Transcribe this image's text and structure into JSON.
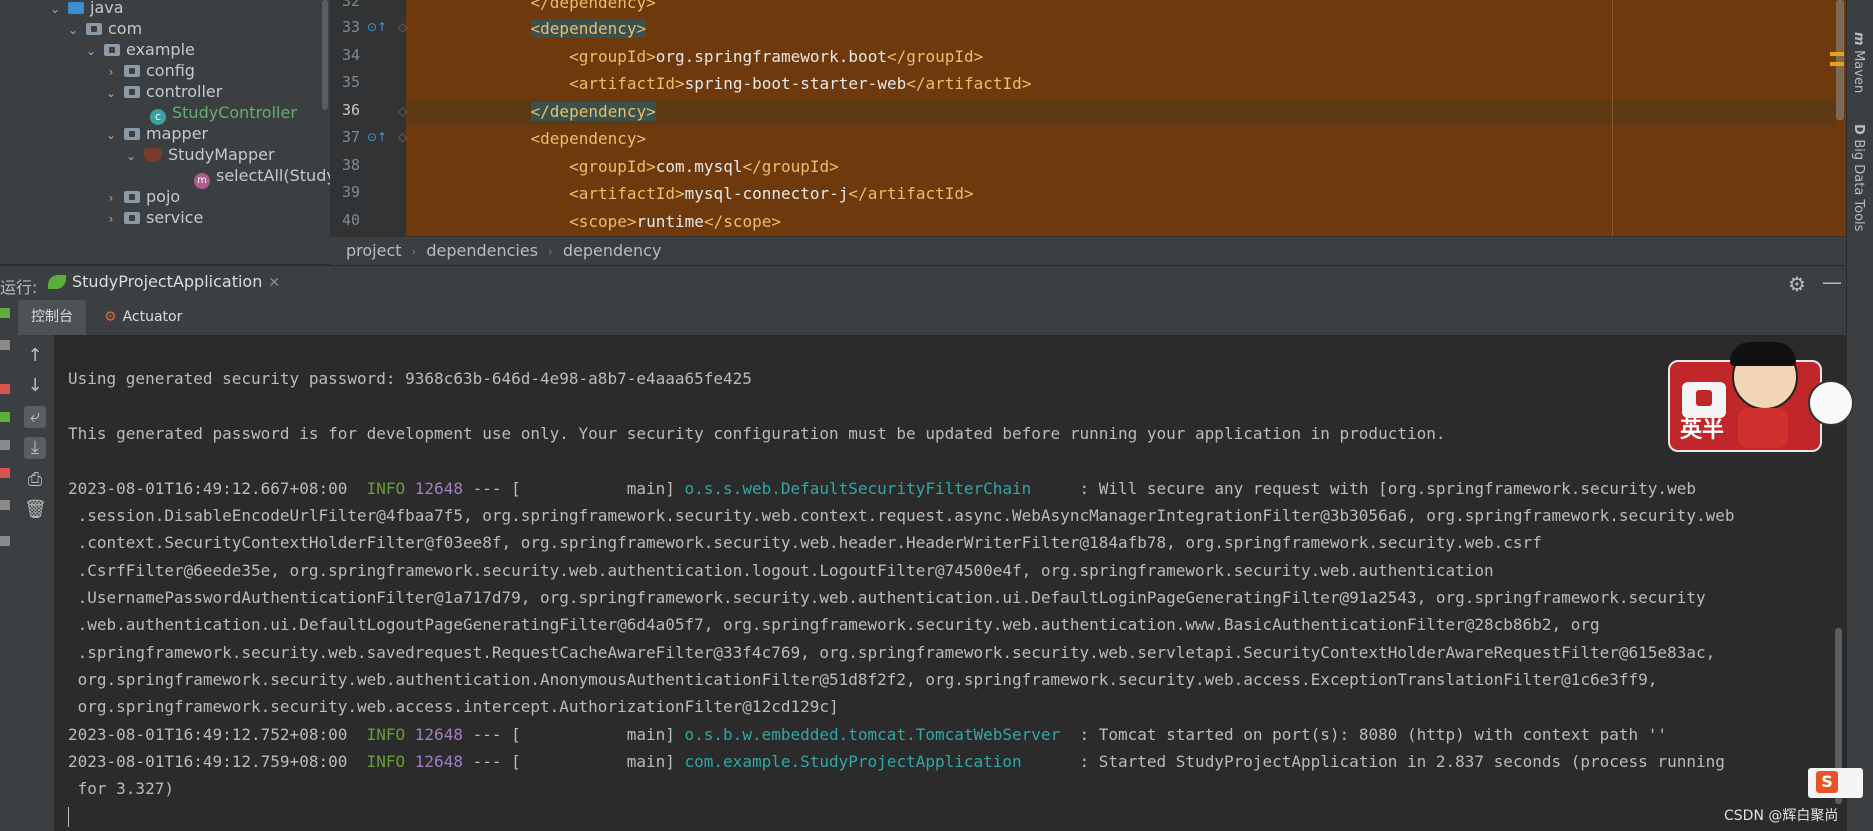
{
  "project_tree": {
    "items": [
      {
        "label": "java",
        "depth": 0,
        "chevron": "⌄",
        "icon": "folder-source-icon"
      },
      {
        "label": "com",
        "depth": 1,
        "chevron": "⌄",
        "icon": "package-icon"
      },
      {
        "label": "example",
        "depth": 2,
        "chevron": "⌄",
        "icon": "package-icon"
      },
      {
        "label": "config",
        "depth": 3,
        "chevron": "›",
        "icon": "package-icon"
      },
      {
        "label": "controller",
        "depth": 3,
        "chevron": "⌄",
        "icon": "package-icon"
      },
      {
        "label": "StudyController",
        "depth": 4,
        "chevron": "",
        "icon": "class-icon"
      },
      {
        "label": "mapper",
        "depth": 3,
        "chevron": "⌄",
        "icon": "package-icon"
      },
      {
        "label": "StudyMapper",
        "depth": 4,
        "chevron": "⌄",
        "icon": "mybatis-mapper-icon"
      },
      {
        "label": "selectAll(Study):",
        "depth": 5,
        "chevron": "",
        "icon": "method-icon"
      },
      {
        "label": "pojo",
        "depth": 3,
        "chevron": "›",
        "icon": "package-icon"
      },
      {
        "label": "service",
        "depth": 3,
        "chevron": "›",
        "icon": "package-icon"
      }
    ]
  },
  "editor": {
    "lines": [
      {
        "no": "32",
        "indent": "    ",
        "open": "</dependency>",
        "text": "",
        "close": ""
      },
      {
        "no": "33",
        "indent": "    ",
        "open": "<dependency>",
        "text": "",
        "close": ""
      },
      {
        "no": "34",
        "indent": "        ",
        "open": "<groupId>",
        "text": "org.springframework.boot",
        "close": "</groupId>"
      },
      {
        "no": "35",
        "indent": "        ",
        "open": "<artifactId>",
        "text": "spring-boot-starter-web",
        "close": "</artifactId>"
      },
      {
        "no": "36",
        "indent": "    ",
        "open": "</dependency>",
        "text": "",
        "close": ""
      },
      {
        "no": "37",
        "indent": "    ",
        "open": "<dependency>",
        "text": "",
        "close": ""
      },
      {
        "no": "38",
        "indent": "        ",
        "open": "<groupId>",
        "text": "com.mysql",
        "close": "</groupId>"
      },
      {
        "no": "39",
        "indent": "        ",
        "open": "<artifactId>",
        "text": "mysql-connector-j",
        "close": "</artifactId>"
      },
      {
        "no": "40",
        "indent": "        ",
        "open": "<scope>",
        "text": "runtime",
        "close": "</scope>"
      }
    ],
    "current_line": "36",
    "breadcrumb": [
      "project",
      "dependencies",
      "dependency"
    ]
  },
  "right_strip": {
    "maven": "Maven",
    "bigdata": "Big Data Tools"
  },
  "run_window": {
    "label": "运行:",
    "tab": "StudyProjectApplication",
    "subtabs": {
      "console": "控制台",
      "actuator": "Actuator"
    }
  },
  "console": {
    "lines": [
      {
        "plain": "Using generated security password: 9368c63b-646d-4e98-a8b7-e4aaa65fe425"
      },
      {
        "plain": "This generated password is for development use only. Your security configuration must be updated before running your application in production."
      },
      {
        "ts": "2023-08-01T16:49:12.667+08:00  ",
        "level": "INFO",
        "pid": " 12648",
        "mid": " --- [           main] ",
        "logger": "o.s.s.web.DefaultSecurityFilterChain    ",
        "msg": " : Will secure any request with [org.springframework.security.web"
      },
      {
        "plain": " .session.DisableEncodeUrlFilter@4fbaa7f5, org.springframework.security.web.context.request.async.WebAsyncManagerIntegrationFilter@3b3056a6, org.springframework.security.web"
      },
      {
        "plain": " .context.SecurityContextHolderFilter@f03ee8f, org.springframework.security.web.header.HeaderWriterFilter@184afb78, org.springframework.security.web.csrf"
      },
      {
        "plain": " .CsrfFilter@6eede35e, org.springframework.security.web.authentication.logout.LogoutFilter@74500e4f, org.springframework.security.web.authentication"
      },
      {
        "plain": " .UsernamePasswordAuthenticationFilter@1a717d79, org.springframework.security.web.authentication.ui.DefaultLoginPageGeneratingFilter@91a2543, org.springframework.security"
      },
      {
        "plain": " .web.authentication.ui.DefaultLogoutPageGeneratingFilter@6d4a05f7, org.springframework.security.web.authentication.www.BasicAuthenticationFilter@28cb86b2, org"
      },
      {
        "plain": " .springframework.security.web.savedrequest.RequestCacheAwareFilter@33f4c769, org.springframework.security.web.servletapi.SecurityContextHolderAwareRequestFilter@615e83ac,"
      },
      {
        "plain": " org.springframework.security.web.authentication.AnonymousAuthenticationFilter@51d8f2f2, org.springframework.security.web.access.ExceptionTranslationFilter@1c6e3ff9,"
      },
      {
        "plain": " org.springframework.security.web.access.intercept.AuthorizationFilter@12cd129c]"
      },
      {
        "ts": "2023-08-01T16:49:12.752+08:00  ",
        "level": "INFO",
        "pid": " 12648",
        "mid": " --- [           main] ",
        "logger": "o.s.b.w.embedded.tomcat.TomcatWebServer ",
        "msg": " : Tomcat started on port(s): 8080 (http) with context path ''"
      },
      {
        "ts": "2023-08-01T16:49:12.759+08:00  ",
        "level": "INFO",
        "pid": " 12648",
        "mid": " --- [           main] ",
        "logger": "com.example.StudyProjectApplication     ",
        "msg": " : Started StudyProjectApplication in 2.837 seconds (process running"
      },
      {
        "plain": " for 3.327)"
      }
    ]
  },
  "sticker": {
    "text": "英半"
  },
  "watermark": "CSDN @辉白聚尚",
  "colors": {
    "editor_bg": "#6e3a0d",
    "console_bg": "#2b2b2b",
    "info": "#6a9b3a",
    "pid": "#a17ec7",
    "logger": "#2fa8a8",
    "xml_tag": "#e8bf6a",
    "accent": "#4a88c7"
  }
}
